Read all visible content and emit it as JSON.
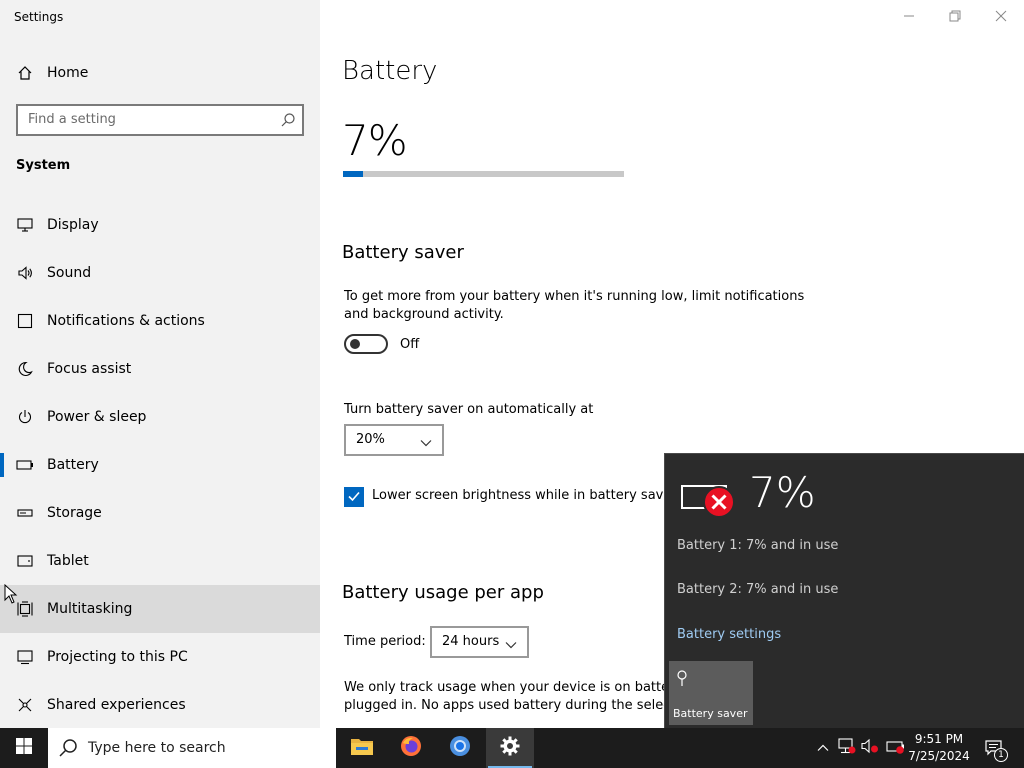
{
  "window": {
    "title": "Settings"
  },
  "sidebar": {
    "home_label": "Home",
    "search_placeholder": "Find a setting",
    "section_heading": "System",
    "items": [
      {
        "label": "Display",
        "icon": "monitor-icon"
      },
      {
        "label": "Sound",
        "icon": "speaker-icon"
      },
      {
        "label": "Notifications & actions",
        "icon": "notification-icon"
      },
      {
        "label": "Focus assist",
        "icon": "moon-icon"
      },
      {
        "label": "Power & sleep",
        "icon": "power-icon"
      },
      {
        "label": "Battery",
        "icon": "battery-icon",
        "selected": true
      },
      {
        "label": "Storage",
        "icon": "storage-icon"
      },
      {
        "label": "Tablet",
        "icon": "tablet-icon"
      },
      {
        "label": "Multitasking",
        "icon": "multitasking-icon",
        "hovered": true
      },
      {
        "label": "Projecting to this PC",
        "icon": "projector-icon"
      },
      {
        "label": "Shared experiences",
        "icon": "shared-icon"
      }
    ]
  },
  "main": {
    "title": "Battery",
    "battery_percent": "7%",
    "battery_level": 0.07,
    "saver": {
      "heading": "Battery saver",
      "description_line1": "To get more from your battery when it's running low, limit notifications",
      "description_line2": "and background activity.",
      "toggle_state": "Off",
      "auto_label": "Turn battery saver on automatically at",
      "auto_value": "20%",
      "brightness_label": "Lower screen brightness while in battery saver",
      "brightness_checked": true
    },
    "usage": {
      "heading": "Battery usage per app",
      "time_period_label": "Time period:",
      "time_period_value": "24 hours",
      "note_line1": "We only track usage when your device is on battery",
      "note_line2": "plugged in. No apps used battery during the selecte"
    }
  },
  "flyout": {
    "percent": "7%",
    "battery1": "Battery 1: 7% and in use",
    "battery2": "Battery 2: 7% and in use",
    "settings_link": "Battery settings",
    "saver_tile_label": "Battery saver"
  },
  "taskbar": {
    "search_placeholder": "Type here to search",
    "time": "9:51 PM",
    "date": "7/25/2024",
    "notification_count": "1"
  },
  "colors": {
    "accent": "#0067c0",
    "sidebar_bg": "#f2f2f2",
    "flyout_bg": "#2b2b2b",
    "taskbar_bg": "#1c1c1c",
    "link": "#9fcbf2",
    "error_red": "#e81123"
  }
}
